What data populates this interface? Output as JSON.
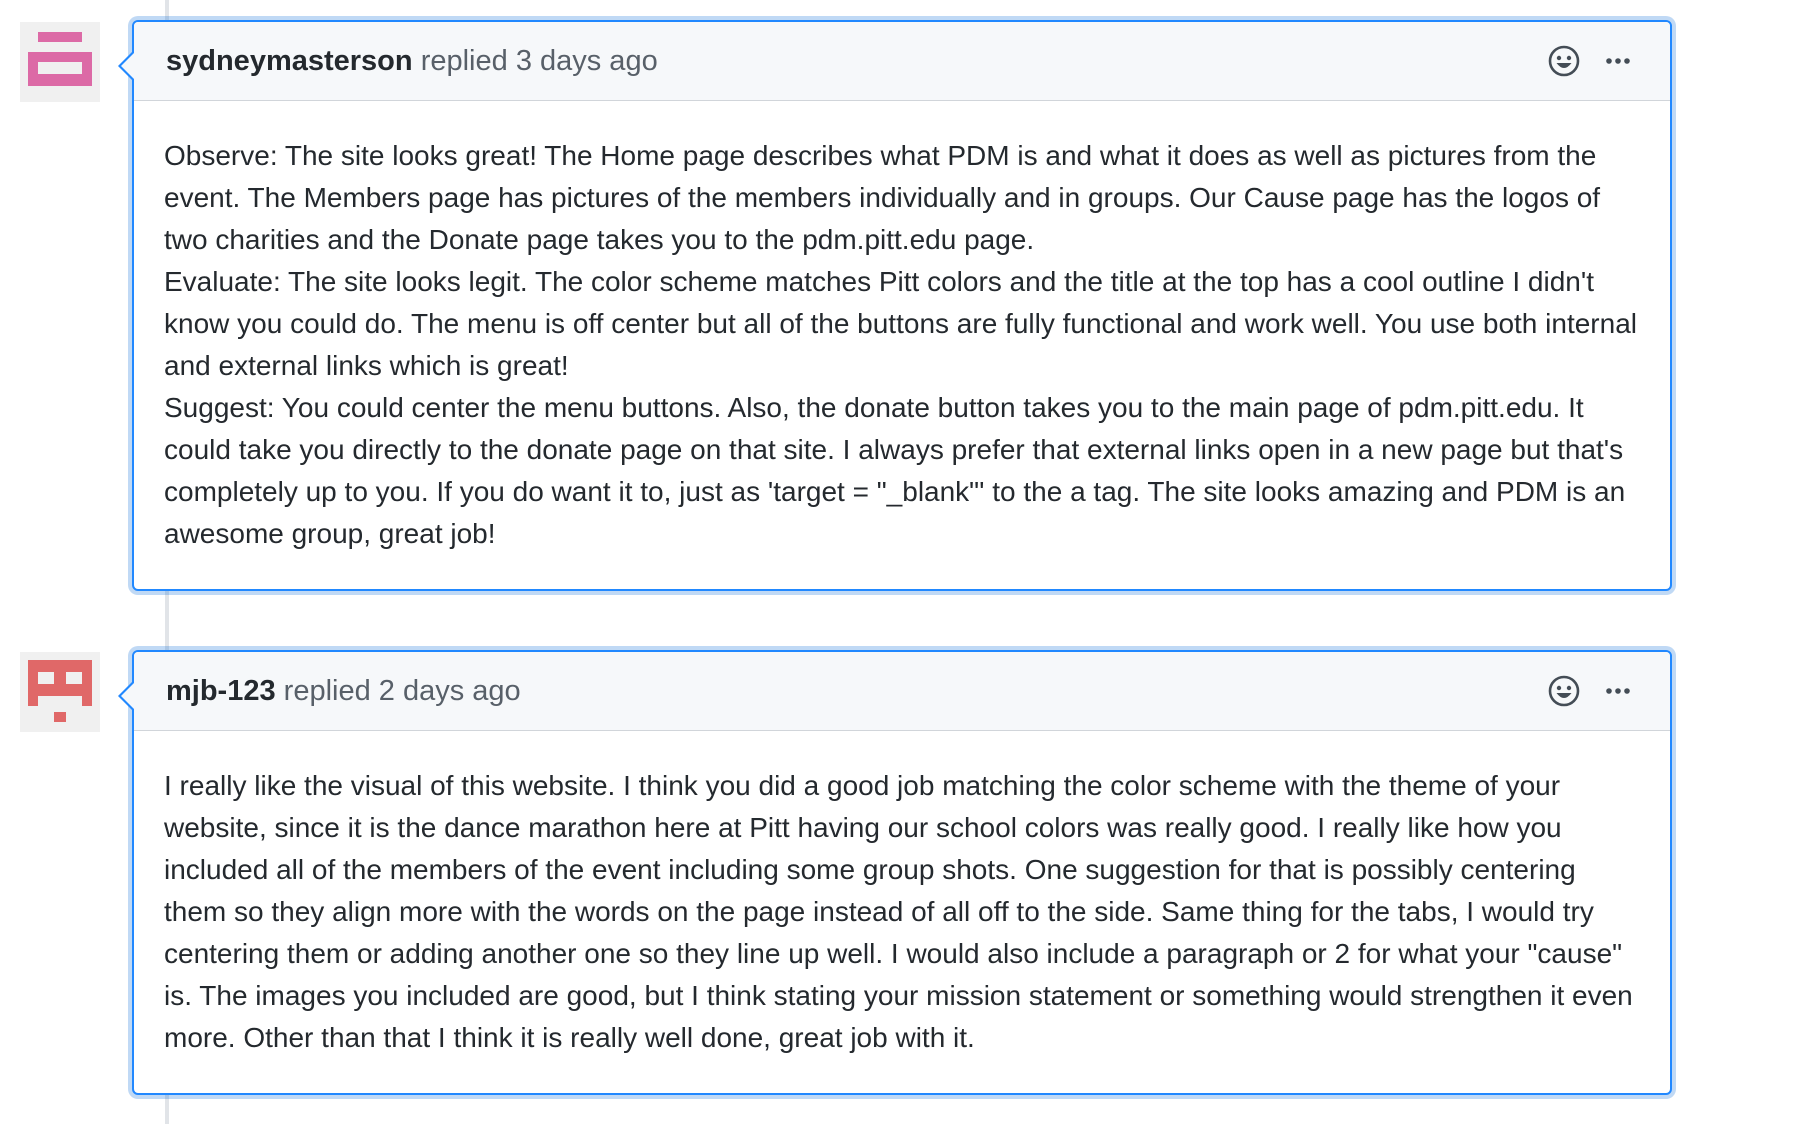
{
  "comments": [
    {
      "author": "sydneymasterson",
      "action": "replied",
      "time": "3 days ago",
      "avatar_color": "#dc6aa6",
      "paragraphs": [
        "Observe: The site looks great! The Home page describes what PDM is and what it does as well as pictures from the event. The Members page has pictures of the members individually and in groups. Our Cause page has the logos of two charities and the Donate page takes you to the pdm.pitt.edu page.",
        "Evaluate: The site looks legit. The color scheme matches Pitt colors and the title at the top has a cool outline I didn't know you could do. The menu is off center but all of the buttons are fully functional and work well. You use both internal and external links which is great!",
        "Suggest: You could center the menu buttons. Also, the donate button takes you to the main page of pdm.pitt.edu. It could take you directly to the donate page on that site. I always prefer that external links open in a new page but that's completely up to you. If you do want it to, just as 'target = \"_blank\"' to the a tag. The site looks amazing and PDM is an awesome group, great job!"
      ]
    },
    {
      "author": "mjb-123",
      "action": "replied",
      "time": "2 days ago",
      "avatar_color": "#e06868",
      "paragraphs": [
        "I really like the visual of this website. I think you did a good job matching the color scheme with the theme of your website, since it is the dance marathon here at Pitt having our school colors was really good. I really like how you included all of the members of the event including some group shots. One suggestion for that is possibly centering them so they align more with the words on the page instead of all off to the side. Same thing for the tabs, I would try centering them or adding another one so they line up well. I would also include a paragraph or 2 for what your \"cause\" is. The images you included are good, but I think stating your mission statement or something would strengthen it even more. Other than that I think it is really well done, great job with it."
      ]
    }
  ],
  "icons": {
    "reaction": "smiley-icon",
    "menu": "kebab-horizontal-icon"
  },
  "colors": {
    "focus_border": "#2188ff",
    "header_bg": "#f6f8fa",
    "meta_text": "#586069"
  }
}
